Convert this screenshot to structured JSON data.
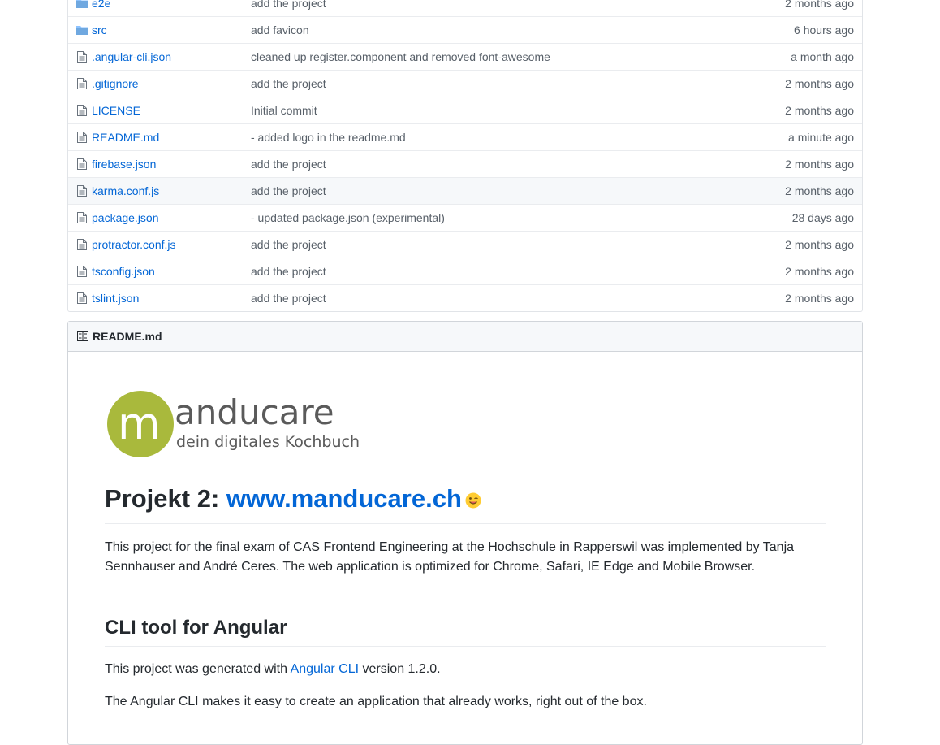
{
  "files": [
    {
      "type": "dir",
      "name": "e2e",
      "message": "add the project",
      "age": "2 months ago"
    },
    {
      "type": "dir",
      "name": "src",
      "message": "add favicon",
      "age": "6 hours ago"
    },
    {
      "type": "file",
      "name": ".angular-cli.json",
      "message": "cleaned up register.component and removed font-awesome",
      "age": "a month ago"
    },
    {
      "type": "file",
      "name": ".gitignore",
      "message": "add the project",
      "age": "2 months ago"
    },
    {
      "type": "file",
      "name": "LICENSE",
      "message": "Initial commit",
      "age": "2 months ago"
    },
    {
      "type": "file",
      "name": "README.md",
      "message": "- added logo in the readme.md",
      "age": "a minute ago"
    },
    {
      "type": "file",
      "name": "firebase.json",
      "message": "add the project",
      "age": "2 months ago"
    },
    {
      "type": "file",
      "name": "karma.conf.js",
      "message": "add the project",
      "age": "2 months ago"
    },
    {
      "type": "file",
      "name": "package.json",
      "message": "- updated package.json (experimental)",
      "age": "28 days ago"
    },
    {
      "type": "file",
      "name": "protractor.conf.js",
      "message": "add the project",
      "age": "2 months ago"
    },
    {
      "type": "file",
      "name": "tsconfig.json",
      "message": "add the project",
      "age": "2 months ago"
    },
    {
      "type": "file",
      "name": "tslint.json",
      "message": "add the project",
      "age": "2 months ago"
    }
  ],
  "readme": {
    "header": "README.md",
    "logo": {
      "letter": "m",
      "rest": "anducare",
      "tagline": "dein digitales Kochbuch",
      "accent": "#a9b93c"
    },
    "h1_prefix": "Projekt 2: ",
    "h1_link": "www.manducare.ch",
    "intro": "This project for the final exam of CAS Frontend Engineering at the Hochschule in Rapperswil was implemented by Tanja Sennhauser and André Ceres. The web application is optimized for Chrome, Safari, IE Edge and Mobile Browser.",
    "h2": "CLI tool for Angular",
    "generated_prefix": "This project was generated with ",
    "generated_link": "Angular CLI",
    "generated_suffix": " version 1.2.0.",
    "cli_text": "The Angular CLI makes it easy to create an application that already works, right out of the box."
  },
  "colors": {
    "link": "#0366d6",
    "folder_icon": "#79b8ff",
    "muted": "#586069"
  }
}
